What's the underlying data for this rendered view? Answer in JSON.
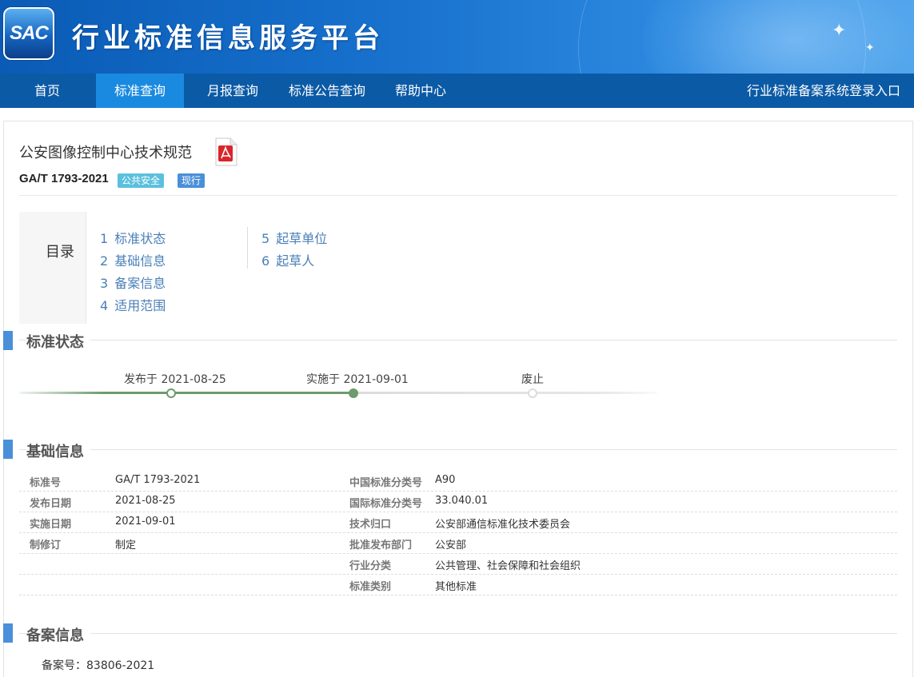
{
  "header": {
    "logo_text": "SAC",
    "site_title": "行业标准信息服务平台"
  },
  "nav": {
    "items": [
      {
        "label": "首页"
      },
      {
        "label": "标准查询"
      },
      {
        "label": "月报查询"
      },
      {
        "label": "标准公告查询"
      },
      {
        "label": "帮助中心"
      }
    ],
    "active_index": 1,
    "login_link": "行业标准备案系统登录入口"
  },
  "standard": {
    "title": "公安图像控制中心技术规范",
    "number": "GA/T 1793-2021",
    "tags": [
      "公共安全",
      "现行"
    ]
  },
  "toc": {
    "label": "目录",
    "items": [
      {
        "num": "1",
        "label": "标准状态"
      },
      {
        "num": "2",
        "label": "基础信息"
      },
      {
        "num": "3",
        "label": "备案信息"
      },
      {
        "num": "4",
        "label": "适用范围"
      },
      {
        "num": "5",
        "label": "起草单位"
      },
      {
        "num": "6",
        "label": "起草人"
      }
    ]
  },
  "sections": {
    "status": "标准状态",
    "basic": "基础信息",
    "filing": "备案信息"
  },
  "timeline": {
    "published": "发布于 2021-08-25",
    "implemented": "实施于 2021-09-01",
    "abolished": "废止"
  },
  "basic_info": {
    "left": [
      {
        "key": "标准号",
        "value": "GA/T 1793-2021"
      },
      {
        "key": "发布日期",
        "value": "2021-08-25"
      },
      {
        "key": "实施日期",
        "value": "2021-09-01"
      },
      {
        "key": "制修订",
        "value": "制定"
      }
    ],
    "right": [
      {
        "key": "中国标准分类号",
        "value": "A90"
      },
      {
        "key": "国际标准分类号",
        "value": "33.040.01"
      },
      {
        "key": "技术归口",
        "value": "公安部通信标准化技术委员会"
      },
      {
        "key": "批准发布部门",
        "value": "公安部"
      },
      {
        "key": "行业分类",
        "value": "公共管理、社会保障和社会组织"
      },
      {
        "key": "标准类别",
        "value": "其他标准"
      }
    ]
  },
  "filing_info": {
    "record_no": "备案号：83806-2021"
  },
  "colors": {
    "nav_bg": "#0b5aa6",
    "nav_active": "#1a8ae0",
    "accent": "#4a90d9",
    "timeline_done": "#6d9b6d"
  }
}
